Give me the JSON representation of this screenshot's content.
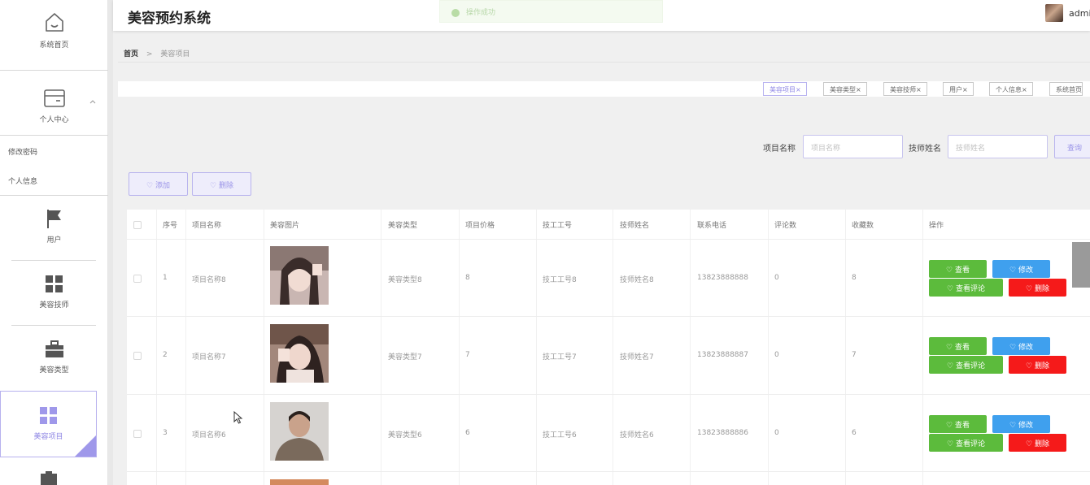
{
  "app": {
    "title": "美容预约系统",
    "user": "admi"
  },
  "toast": {
    "message": "操作成功"
  },
  "sidebar": {
    "items": [
      {
        "label": "系统首页",
        "icon": "home-icon"
      },
      {
        "label": "个人中心",
        "icon": "card-icon"
      },
      {
        "label": "用户",
        "icon": "flag-icon"
      },
      {
        "label": "美容技师",
        "icon": "grid-icon"
      },
      {
        "label": "美容类型",
        "icon": "briefcase-icon"
      },
      {
        "label": "美容项目",
        "icon": "grid-icon"
      }
    ],
    "submenu": [
      "修改密码",
      "个人信息"
    ]
  },
  "breadcrumb": {
    "home": "首页",
    "separator": ">",
    "current": "美容项目"
  },
  "tags": [
    "美容项目",
    "美容类型",
    "美容技师",
    "用户",
    "个人信息",
    "系统首页"
  ],
  "tag_close": "×",
  "search": {
    "project_label": "项目名称",
    "project_placeholder": "项目名称",
    "tech_label": "技师姓名",
    "tech_placeholder": "技师姓名",
    "query_button": "查询"
  },
  "toolbar": {
    "add": "添加",
    "delete": "删除"
  },
  "table": {
    "headers": [
      "序号",
      "项目名称",
      "美容图片",
      "美容类型",
      "项目价格",
      "技工工号",
      "技师姓名",
      "联系电话",
      "评论数",
      "收藏数",
      "操作"
    ],
    "rows": [
      {
        "index": "1",
        "name": "项目名称8",
        "type": "美容类型8",
        "price": "8",
        "worker_no": "技工工号8",
        "tech": "技师姓名8",
        "phone": "13823888888",
        "comments": "0",
        "favorites": "8"
      },
      {
        "index": "2",
        "name": "项目名称7",
        "type": "美容类型7",
        "price": "7",
        "worker_no": "技工工号7",
        "tech": "技师姓名7",
        "phone": "13823888887",
        "comments": "0",
        "favorites": "7"
      },
      {
        "index": "3",
        "name": "项目名称6",
        "type": "美容类型6",
        "price": "6",
        "worker_no": "技工工号6",
        "tech": "技师姓名6",
        "phone": "13823888886",
        "comments": "0",
        "favorites": "6"
      }
    ],
    "actions": {
      "view": "查看",
      "edit": "修改",
      "view_comments": "查看评论",
      "delete": "删除"
    }
  },
  "colors": {
    "accent": "#9f98ea",
    "green": "#5cbb3c",
    "blue": "#3fa0ee",
    "red": "#f51a1a"
  }
}
